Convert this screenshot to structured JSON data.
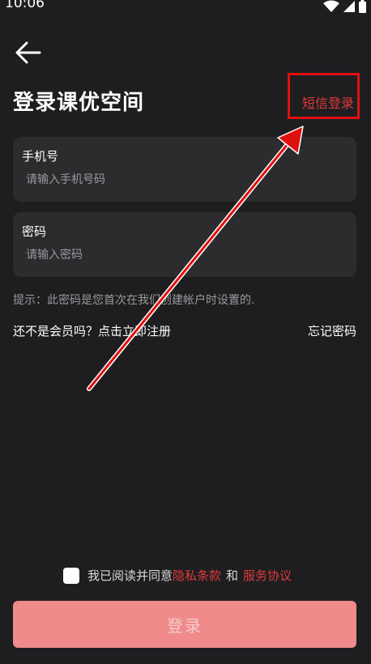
{
  "status_bar": {
    "time": "10:06",
    "icons": [
      "wifi-icon",
      "signal-icon",
      "battery-icon"
    ]
  },
  "header": {
    "title": "登录课优空间",
    "sms_login_label": "短信登录"
  },
  "phone_field": {
    "label": "手机号",
    "placeholder": "请输入手机号码",
    "value": ""
  },
  "password_field": {
    "label": "密码",
    "placeholder": "请输入密码",
    "value": ""
  },
  "hint": "提示：此密码是您首次在我们创建帐户时设置的.",
  "register_prompt": "还不是会员吗？点击立即注册",
  "forgot_password": "忘记密码",
  "agreement": {
    "checked": false,
    "prefix": "我已阅读并同意",
    "privacy_label": "隐私条款",
    "and": "和",
    "service_label": "服务协议"
  },
  "login_button_label": "登录",
  "colors": {
    "background": "#1e1e20",
    "card": "#2c2c2f",
    "accent_red": "#e03a3a",
    "button_disabled": "#ef8b8b",
    "annotation_red": "#e01010"
  }
}
